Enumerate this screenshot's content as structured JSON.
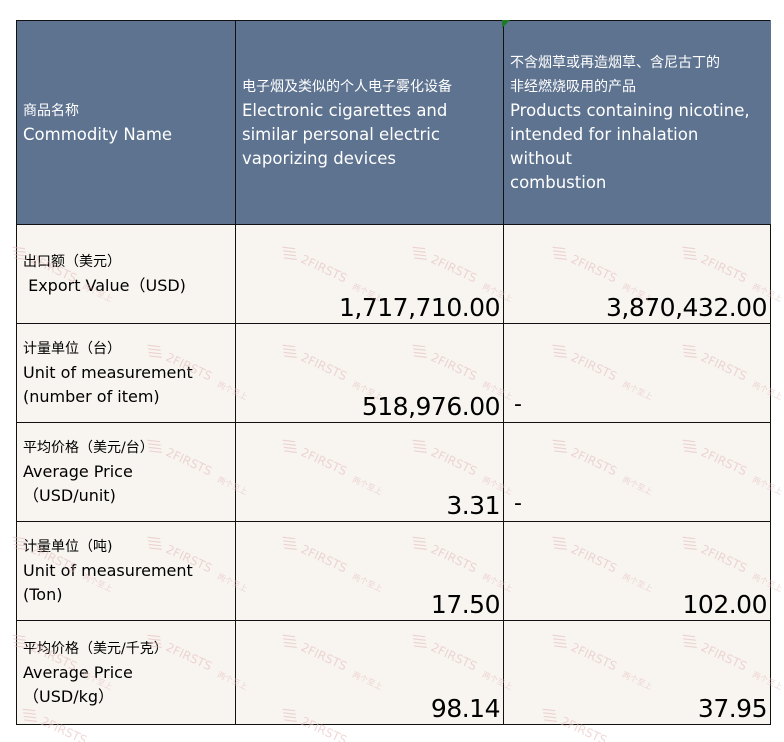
{
  "table": {
    "header": {
      "commodity": {
        "zh": "商品名称",
        "en": "Commodity Name"
      },
      "col1": {
        "zh": "电子烟及类似的个人电子雾化设备",
        "en_lines": [
          "Electronic cigarettes and",
          "similar personal electric",
          "vaporizing devices"
        ]
      },
      "col2": {
        "zh_lines": [
          "不含烟草或再造烟草、含尼古丁的",
          "非经燃烧吸用的产品"
        ],
        "en_lines": [
          "Products containing nicotine,",
          "intended for inhalation without",
          "combustion"
        ]
      }
    },
    "rows": [
      {
        "zh": "出口额（美元）",
        "en_lines": [
          " Export Value（USD)"
        ],
        "v1": "1,717,710.00",
        "v2": "3,870,432.00"
      },
      {
        "zh": "计量单位（台）",
        "en_lines": [
          "Unit of measurement",
          "(number of item)"
        ],
        "v1": "518,976.00",
        "v2": "-"
      },
      {
        "zh": "平均价格（美元/台）",
        "en_lines": [
          "Average Price",
          "（USD/unit)"
        ],
        "v1": "3.31",
        "v2": "-"
      },
      {
        "zh": "计量单位（吨)",
        "en_lines": [
          "Unit of measurement",
          "(Ton)"
        ],
        "v1": "17.50",
        "v2": "102.00"
      },
      {
        "zh": "平均价格（美元/千克）",
        "en_lines": [
          "Average Price",
          "（USD/kg）"
        ],
        "v1": "98.14",
        "v2": "37.95"
      }
    ]
  },
  "watermark": {
    "text": "2FIRSTS",
    "sub": "两个至上"
  },
  "colors": {
    "header_bg": "#5e7390",
    "body_bg": "#f8f5f0",
    "watermark": "#e3b9b9",
    "corner": "#1f7a28"
  }
}
